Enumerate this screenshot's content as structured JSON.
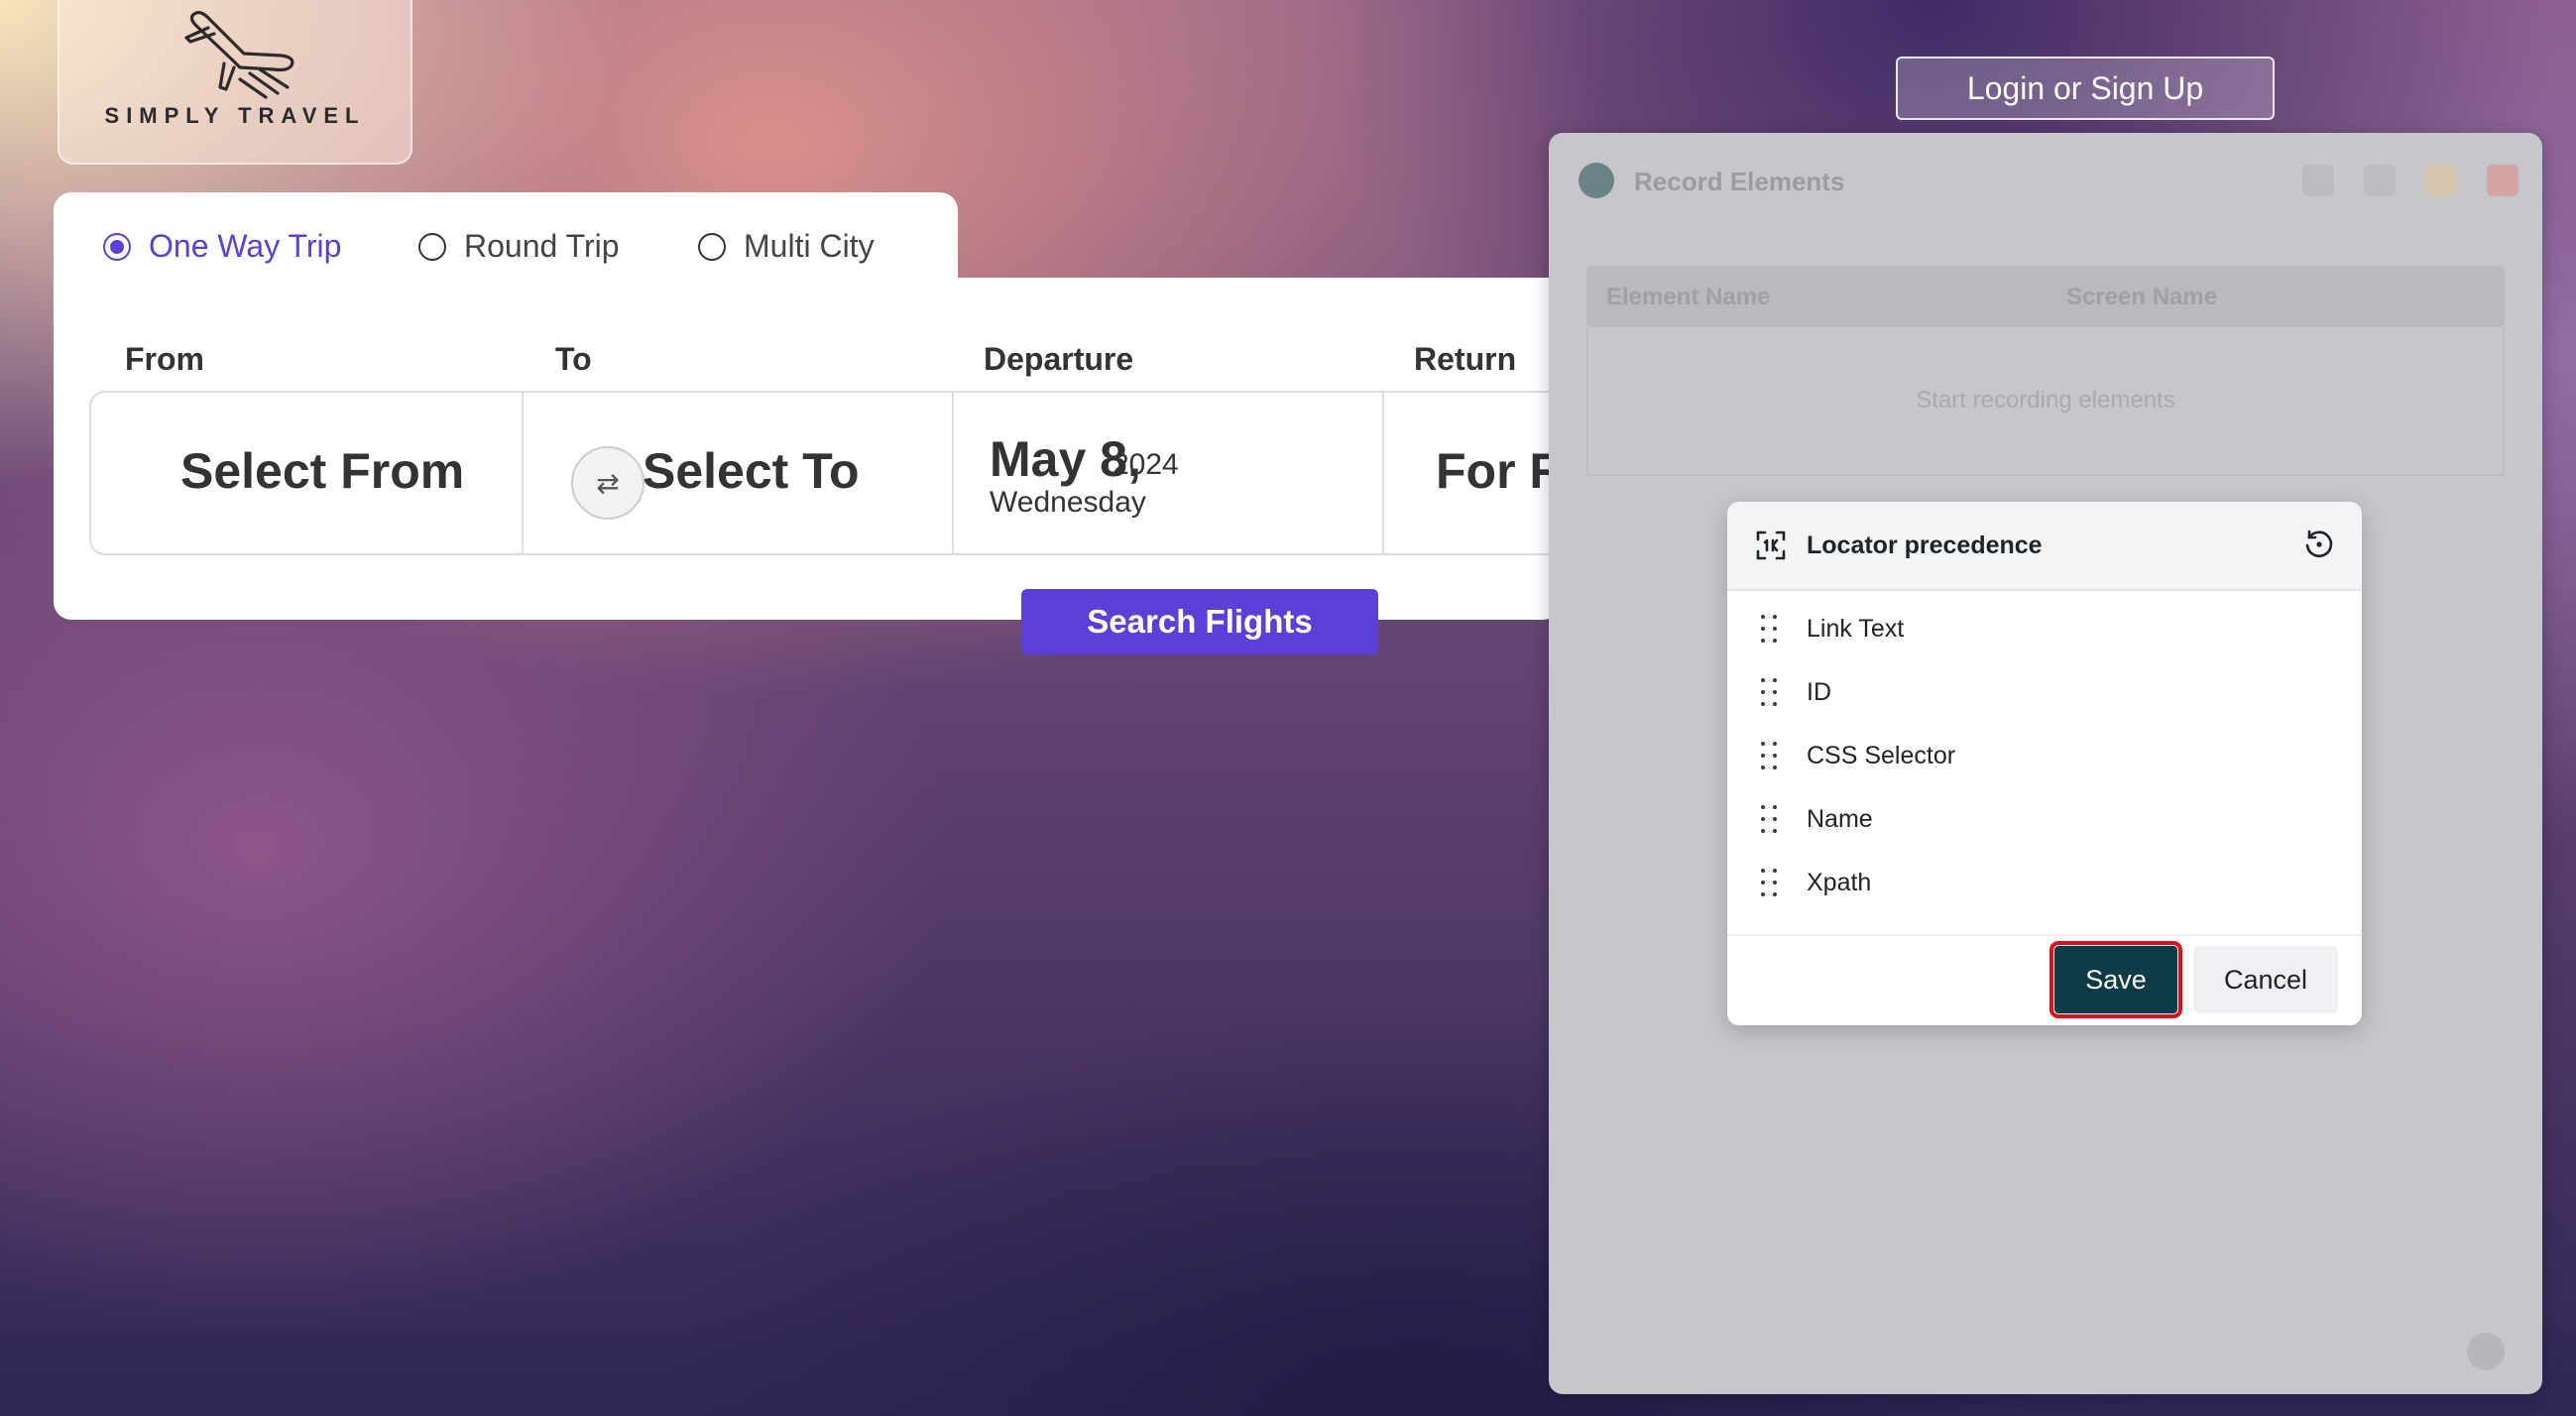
{
  "logo": {
    "text": "SIMPLY TRAVEL",
    "icon": "airplane-icon"
  },
  "header": {
    "login_label": "Login or Sign Up"
  },
  "trip_types": [
    {
      "label": "One Way Trip",
      "selected": true
    },
    {
      "label": "Round Trip",
      "selected": false
    },
    {
      "label": "Multi City",
      "selected": false
    }
  ],
  "columns": {
    "from": "From",
    "to": "To",
    "departure": "Departure",
    "return": "Return"
  },
  "fields": {
    "from_value": "Select From",
    "to_value": "Select To",
    "swap_icon": "⇄",
    "departure_date": "May 8,",
    "departure_year": "2024",
    "departure_weekday": "Wednesday",
    "return_value": "For Re"
  },
  "search_label": "Search Flights",
  "extension": {
    "title": "Record Elements",
    "columns": [
      "Element Name",
      "Screen Name"
    ],
    "empty_text": "Start recording elements"
  },
  "locator_dialog": {
    "title": "Locator precedence",
    "items": [
      "Link Text",
      "ID",
      "CSS Selector",
      "Name",
      "Xpath"
    ],
    "save_label": "Save",
    "cancel_label": "Cancel"
  },
  "colors": {
    "accent": "#5b3fd6",
    "save_bg": "#0d3b48",
    "highlight": "#e0101a"
  }
}
